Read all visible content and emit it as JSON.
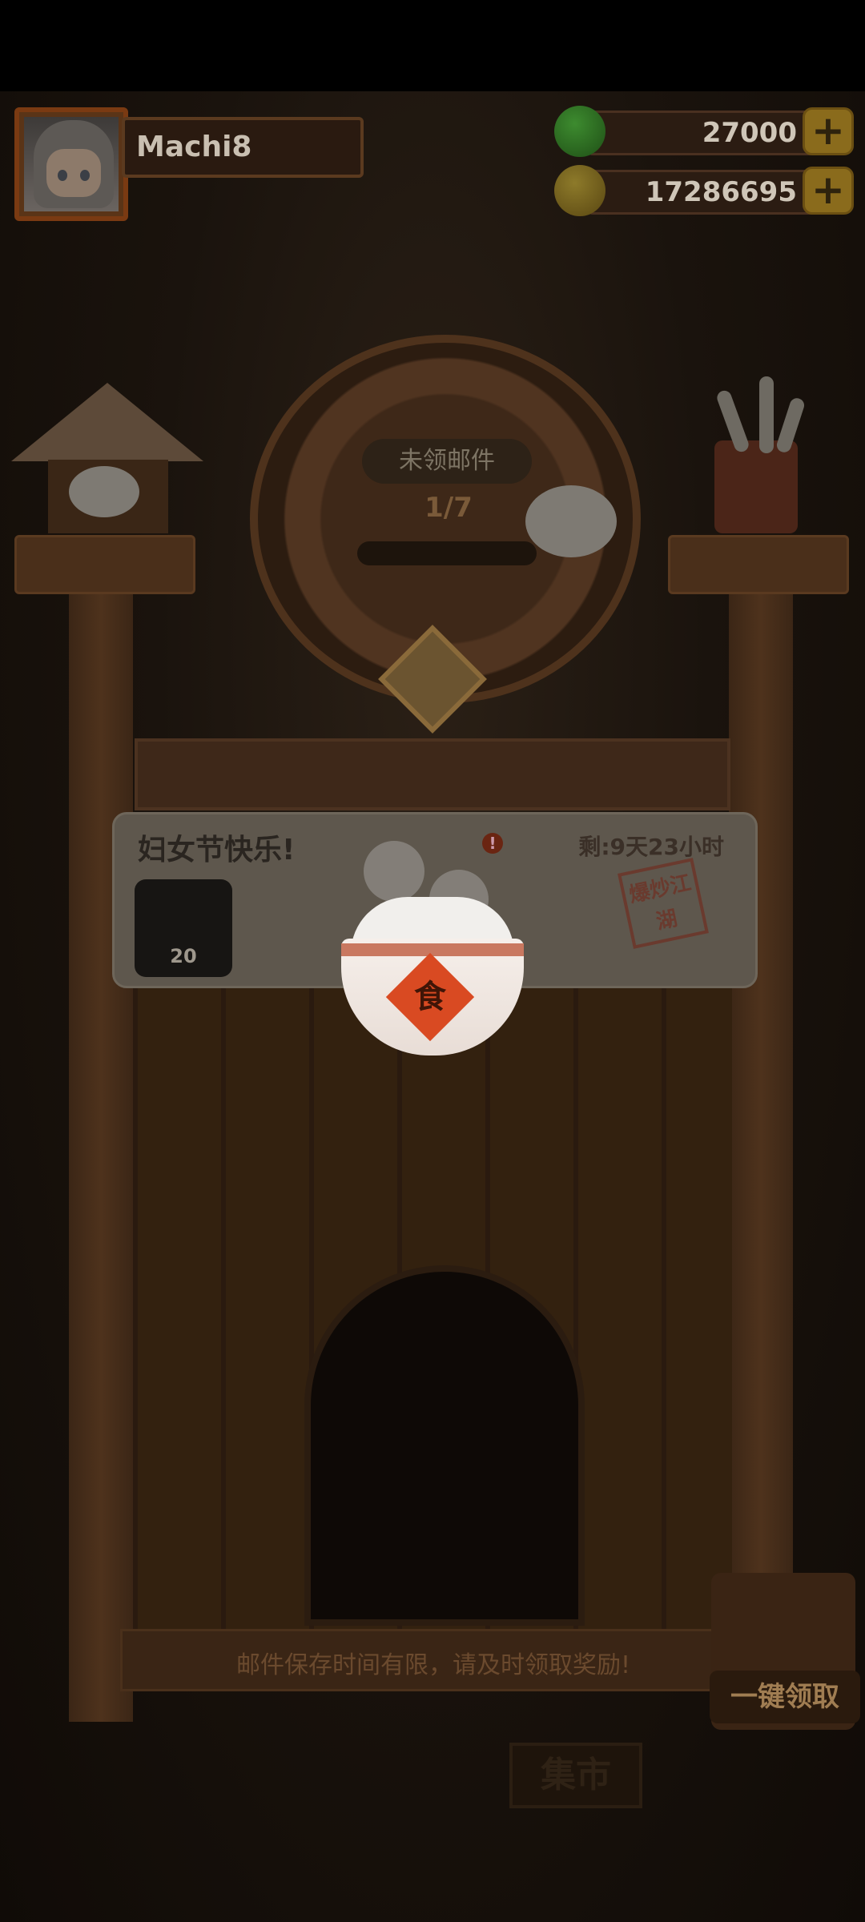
{
  "player": {
    "name": "Machi8"
  },
  "resources": {
    "jade": {
      "value": "27000",
      "icon": "jade-coin-icon"
    },
    "gold": {
      "value": "17286695",
      "icon": "gold-coin-icon"
    },
    "add_label": "+"
  },
  "mailbox": {
    "unclaimed_label": "未领邮件",
    "progress_text": "1/7",
    "progress": {
      "current": 1,
      "total": 7
    }
  },
  "mail": {
    "title": "妇女节快乐!",
    "time_left": "剩:9天23小时",
    "warning_icon": "!",
    "stamp_text": "爆炒江湖",
    "item_count": "20"
  },
  "reward": {
    "bowl_char": "食"
  },
  "footer": {
    "notice": "邮件保存时间有限，请及时领取奖励!",
    "claim_all": "一键领取",
    "market": "集市"
  },
  "colors": {
    "background": "#1a130d",
    "wood": "#3e2819",
    "card": "#5e574d",
    "accent_gold": "#8a6b1c"
  }
}
